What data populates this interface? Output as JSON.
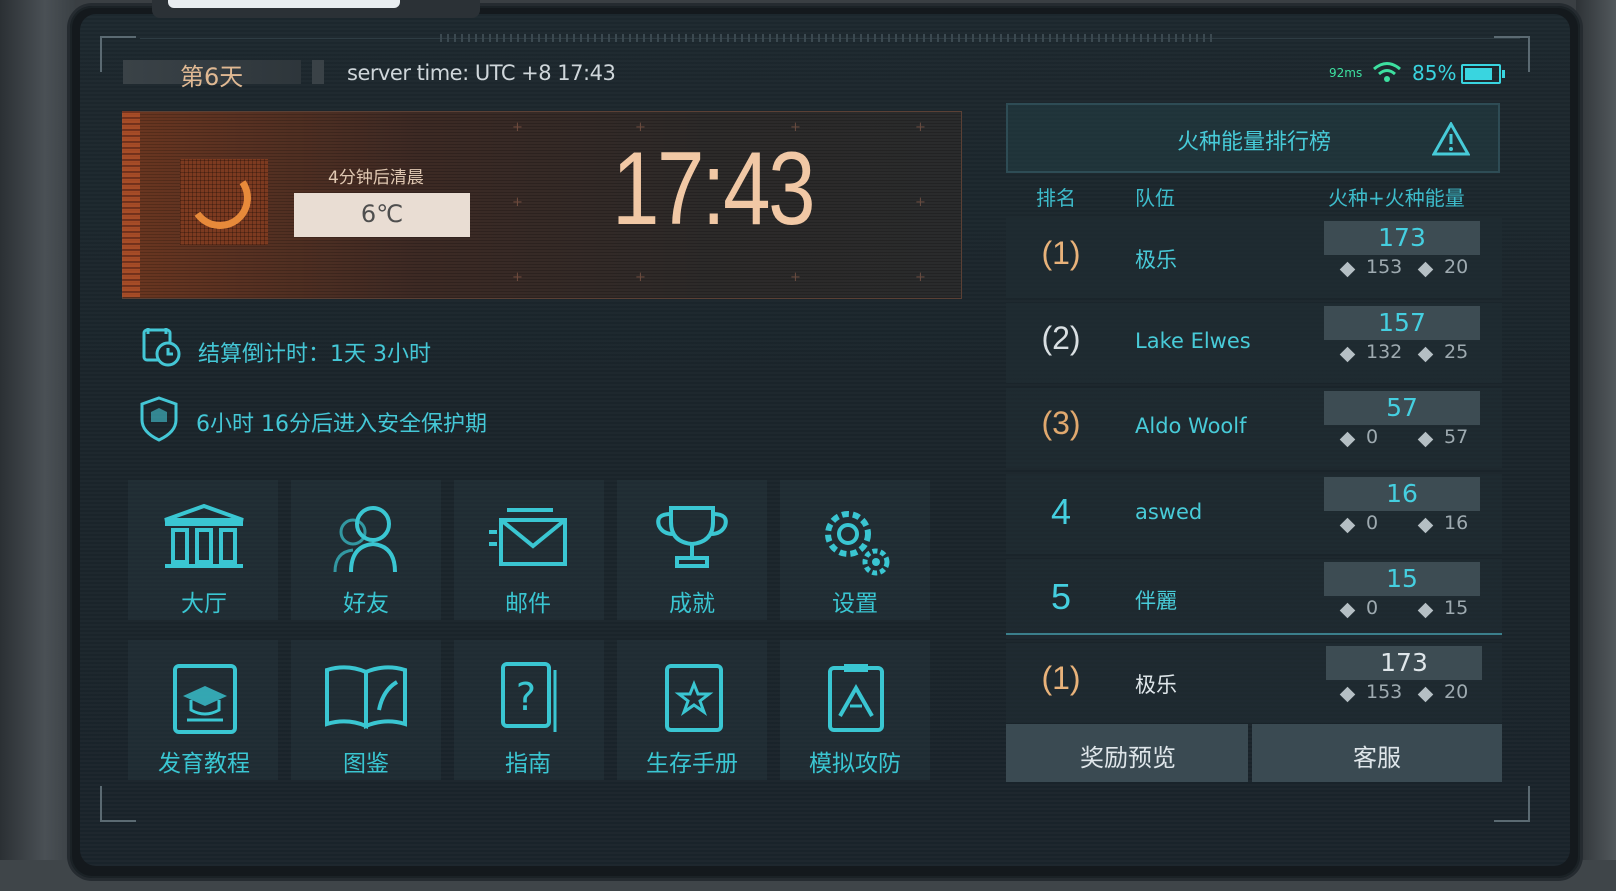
{
  "status_bar": {
    "day_label": "第6天",
    "server_time": "server time: UTC +8 17:43",
    "ping": "92ms",
    "battery_percent": "85%",
    "battery_level": 0.85
  },
  "weather": {
    "clear_label": "4分钟后清晨",
    "temperature": "6℃",
    "clock": "17:43"
  },
  "info": {
    "countdown": "结算倒计时：1天 3小时",
    "protection": "6小时 16分后进入安全保护期"
  },
  "menu": [
    {
      "label": "大厅",
      "icon": "hall-icon"
    },
    {
      "label": "好友",
      "icon": "friends-icon"
    },
    {
      "label": "邮件",
      "icon": "mail-icon"
    },
    {
      "label": "成就",
      "icon": "trophy-icon"
    },
    {
      "label": "设置",
      "icon": "gear-icon"
    },
    {
      "label": "发育教程",
      "icon": "tutorial-icon"
    },
    {
      "label": "图鉴",
      "icon": "codex-icon"
    },
    {
      "label": "指南",
      "icon": "guide-icon"
    },
    {
      "label": "生存手册",
      "icon": "survival-manual-icon"
    },
    {
      "label": "模拟攻防",
      "icon": "simulation-icon"
    }
  ],
  "ranking": {
    "title": "火种能量排行榜",
    "headers": {
      "rank": "排名",
      "team": "队伍",
      "score": "火种+火种能量"
    },
    "rows": [
      {
        "rank": "1",
        "team": "极乐",
        "total": "173",
        "a": "153",
        "b": "20",
        "rank_color": "#e8b27a"
      },
      {
        "rank": "2",
        "team": "Lake Elwes",
        "total": "157",
        "a": "132",
        "b": "25",
        "rank_color": "#d9dfe2"
      },
      {
        "rank": "3",
        "team": "Aldo Woolf",
        "total": "57",
        "a": "0",
        "b": "57",
        "rank_color": "#e0a86e"
      },
      {
        "rank": "4",
        "team": "aswed",
        "total": "16",
        "a": "0",
        "b": "16",
        "rank_color": "#45cfe0"
      },
      {
        "rank": "5",
        "team": "伴麗",
        "total": "15",
        "a": "0",
        "b": "15",
        "rank_color": "#45cfe0"
      }
    ],
    "my_row": {
      "rank": "1",
      "team": "极乐",
      "total": "173",
      "a": "153",
      "b": "20"
    },
    "reward_button": "奖励预览",
    "service_button": "客服"
  },
  "colors": {
    "accent": "#45cfe0",
    "clock": "#f1c8a5",
    "gold": "#e8b27a"
  }
}
